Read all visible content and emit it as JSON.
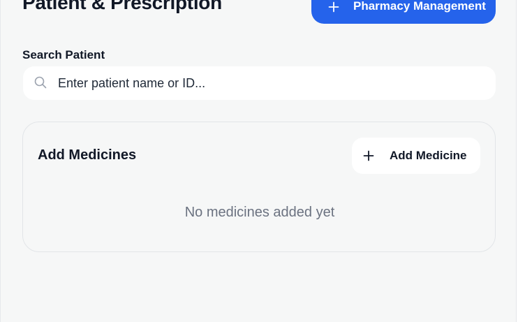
{
  "header": {
    "title": "Patient & Prescription",
    "pharmacy_button_label": "Pharmacy Management"
  },
  "search": {
    "label": "Search Patient",
    "value": "",
    "placeholder": "Enter patient name or ID..."
  },
  "medicines": {
    "title": "Add Medicines",
    "add_button_label": "Add Medicine",
    "empty_message": "No medicines added yet"
  },
  "icons": {
    "plus": "plus-icon",
    "search": "search-icon"
  },
  "colors": {
    "accent": "#2563eb",
    "background": "#f6f7f7",
    "muted_text": "#6b7280"
  }
}
